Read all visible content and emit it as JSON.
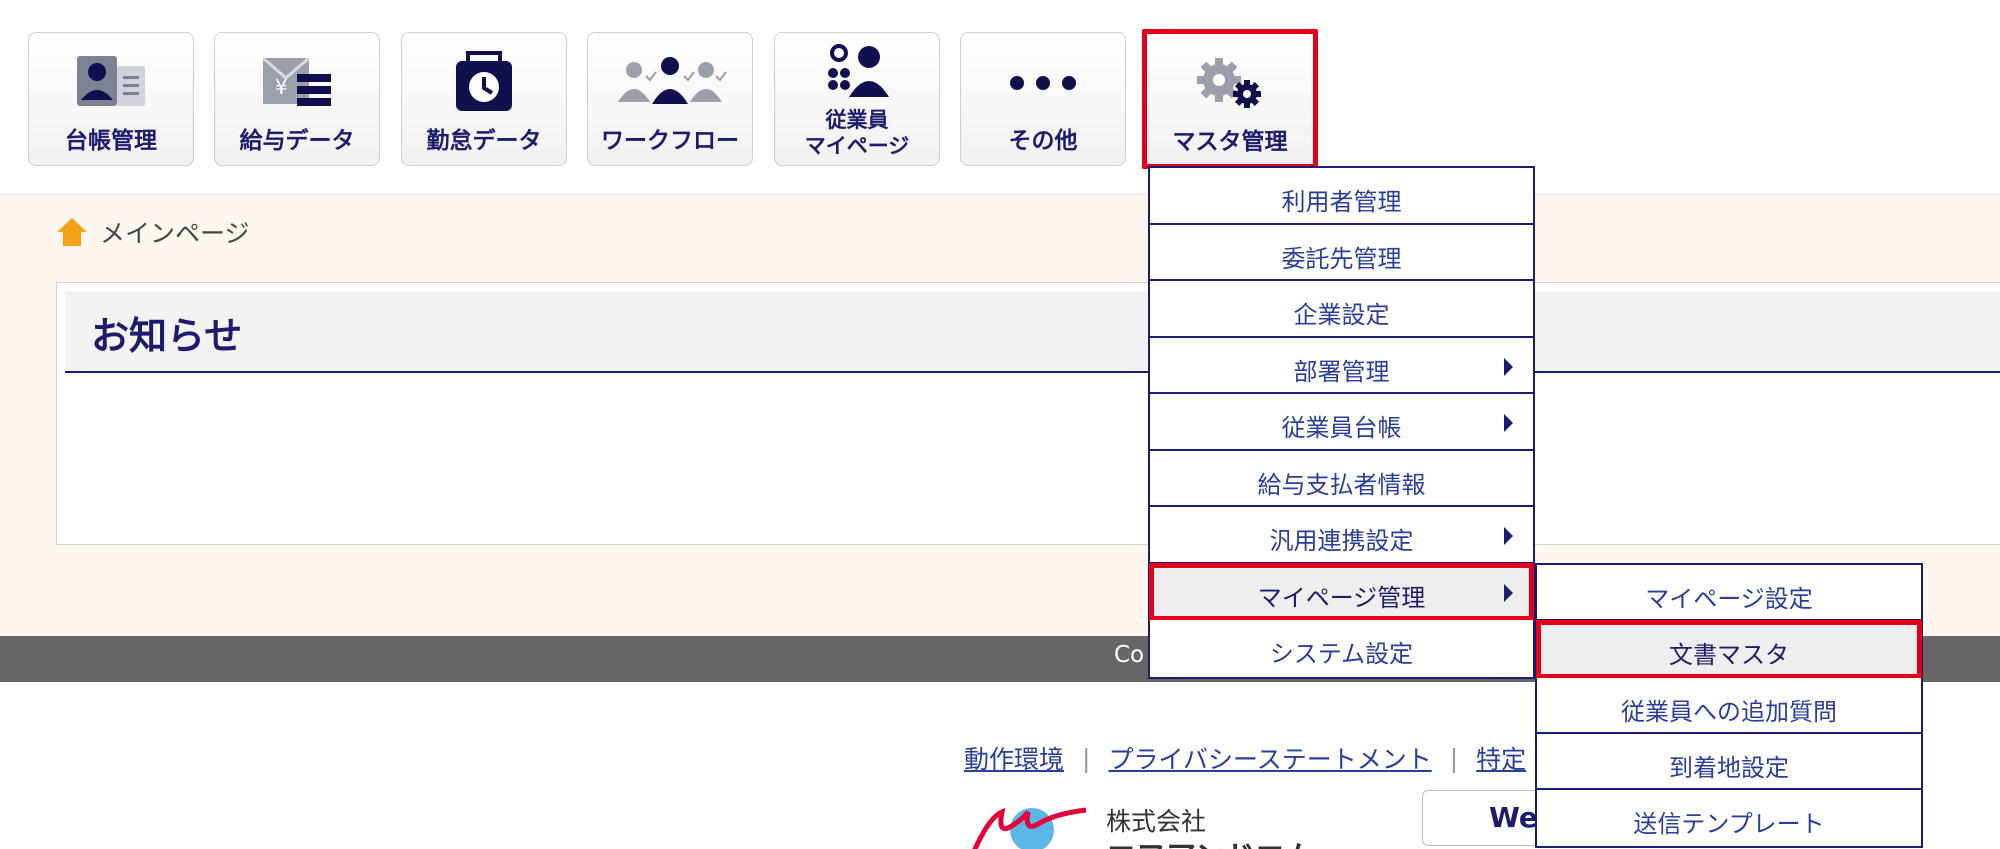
{
  "toolbar": {
    "buttons": [
      {
        "label": "台帳管理",
        "icon": "ledger-icon"
      },
      {
        "label": "給与データ",
        "icon": "payroll-icon"
      },
      {
        "label": "勤怠データ",
        "icon": "attendance-clock-icon"
      },
      {
        "label": "ワークフロー",
        "icon": "workflow-people-icon"
      },
      {
        "label_line1": "従業員",
        "label_line2": "マイページ",
        "icon": "employee-mypage-icon"
      },
      {
        "label": "その他",
        "icon": "more-dots-icon"
      },
      {
        "label": "マスタ管理",
        "icon": "gears-icon"
      }
    ]
  },
  "breadcrumb": {
    "home_icon": "home-icon",
    "current": "メインページ"
  },
  "notice": {
    "title": "お知らせ"
  },
  "menu": {
    "items": [
      {
        "label": "利用者管理"
      },
      {
        "label": "委託先管理"
      },
      {
        "label": "企業設定"
      },
      {
        "label": "部署管理"
      },
      {
        "label": "従業員台帳"
      },
      {
        "label": "給与支払者情報"
      },
      {
        "label": "汎用連携設定"
      },
      {
        "label": "マイページ管理"
      },
      {
        "label": "システム設定"
      }
    ],
    "submenu": [
      {
        "label": "マイページ設定"
      },
      {
        "label": "文書マスタ"
      },
      {
        "label": "従業員への追加質問"
      },
      {
        "label": "到着地設定"
      },
      {
        "label": "送信テンプレート"
      }
    ]
  },
  "footer": {
    "copyright_fragment": "Co",
    "links": [
      "動作環境",
      "プライバシーステートメント",
      "特定"
    ],
    "separator": "|",
    "company_line1": "株式会社",
    "company_line2": "エフアンドエム",
    "web_button_fragment": "We"
  },
  "colors": {
    "navy": "#1c1c6e",
    "highlight_red": "#e4001b",
    "footer_gray": "#666666",
    "content_bg": "#fdf7ef"
  }
}
